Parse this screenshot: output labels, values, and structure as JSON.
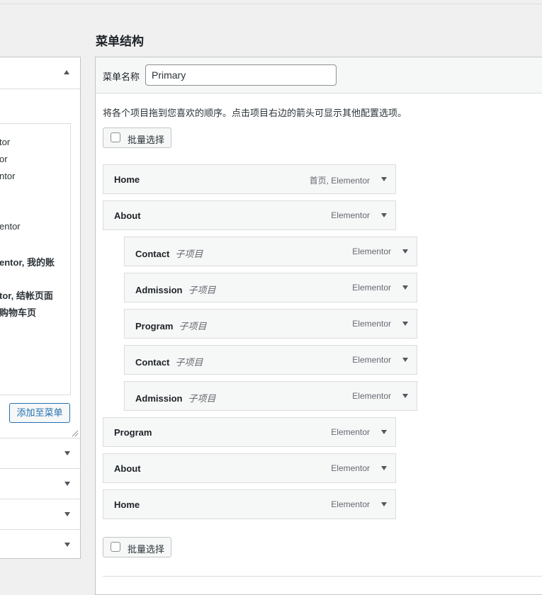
{
  "left_panel": {
    "page_lines": [
      {
        "text": "tor",
        "bold": false
      },
      {
        "text": "or",
        "bold": false
      },
      {
        "text": "ntor",
        "bold": false
      },
      {
        "text": "entor",
        "bold": false
      },
      {
        "text": "entor, 我的账",
        "bold": true
      },
      {
        "text": "tor, 结帐页面",
        "bold": true
      },
      {
        "text": "购物车页",
        "bold": true
      }
    ],
    "add_button_label": "添加至菜单"
  },
  "menu_structure": {
    "title": "菜单结构",
    "name_label": "菜单名称",
    "name_value": "Primary",
    "instructions": "将各个项目拖到您喜欢的顺序。点击项目右边的箭头可显示其他配置选项。",
    "bulk_select_label": "批量选择",
    "items": [
      {
        "title": "Home",
        "sub": "",
        "type": "首页, Elementor",
        "depth": 0
      },
      {
        "title": "About",
        "sub": "",
        "type": "Elementor",
        "depth": 0
      },
      {
        "title": "Contact",
        "sub": "子项目",
        "type": "Elementor",
        "depth": 1
      },
      {
        "title": "Admission",
        "sub": "子项目",
        "type": "Elementor",
        "depth": 1
      },
      {
        "title": "Program",
        "sub": "子项目",
        "type": "Elementor",
        "depth": 1
      },
      {
        "title": "Contact",
        "sub": "子项目",
        "type": "Elementor",
        "depth": 1
      },
      {
        "title": "Admission",
        "sub": "子项目",
        "type": "Elementor",
        "depth": 1
      },
      {
        "title": "Program",
        "sub": "",
        "type": "Elementor",
        "depth": 0
      },
      {
        "title": "About",
        "sub": "",
        "type": "Elementor",
        "depth": 0
      },
      {
        "title": "Home",
        "sub": "",
        "type": "Elementor",
        "depth": 0
      }
    ]
  }
}
